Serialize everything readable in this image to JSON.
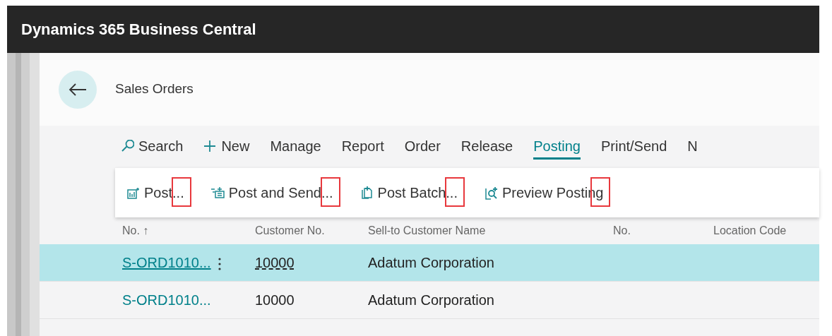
{
  "window": {
    "title": "Dynamics 365 Business Central"
  },
  "page": {
    "title": "Sales Orders"
  },
  "action_bar": [
    {
      "kind": "search",
      "label": "Search",
      "selected": false
    },
    {
      "kind": "new",
      "label": "New",
      "selected": false
    },
    {
      "kind": "menu",
      "label": "Manage",
      "selected": false
    },
    {
      "kind": "menu",
      "label": "Report",
      "selected": false
    },
    {
      "kind": "menu",
      "label": "Order",
      "selected": false
    },
    {
      "kind": "menu",
      "label": "Release",
      "selected": false
    },
    {
      "kind": "menu",
      "label": "Posting",
      "selected": true
    },
    {
      "kind": "menu",
      "label": "Print/Send",
      "selected": false
    },
    {
      "kind": "menu",
      "label": "N",
      "selected": false
    }
  ],
  "submenu": [
    {
      "kind": "post",
      "label": "Post...",
      "highlighted": true
    },
    {
      "kind": "post-send",
      "label": "Post and Send...",
      "highlighted": true
    },
    {
      "kind": "batch",
      "label": "Post Batch...",
      "highlighted": true
    },
    {
      "kind": "preview",
      "label": "Preview Posting",
      "highlighted": true
    }
  ],
  "table": {
    "columns": [
      "No. ↑",
      "Customer No.",
      "Sell-to Customer Name",
      "No.",
      "Location Code"
    ],
    "rows": [
      {
        "selected": true,
        "cells": [
          "S-ORD1010...",
          "10000",
          "Adatum Corporation",
          "",
          ""
        ]
      },
      {
        "selected": false,
        "cells": [
          "S-ORD1010...",
          "10000",
          "Adatum Corporation",
          "",
          ""
        ]
      }
    ]
  }
}
